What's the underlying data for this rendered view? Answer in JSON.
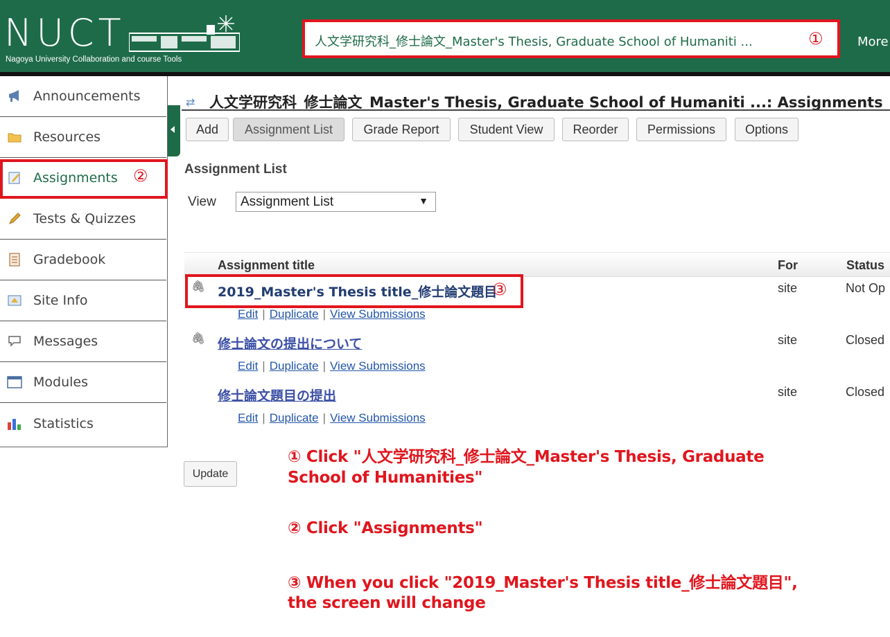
{
  "header": {
    "logo_text": "NUCT",
    "logo_subtitle": "Nagoya University Collaboration and course Tools",
    "site_tab_label": "人文学研究科_修士論文_Master's Thesis, Graduate School of Humaniti ...",
    "site_tab_marker": "①",
    "more_sites_label": "More"
  },
  "sidebar": {
    "items": [
      {
        "label": "Announcements",
        "icon": "megaphone-icon"
      },
      {
        "label": "Resources",
        "icon": "folder-icon"
      },
      {
        "label": "Assignments",
        "icon": "assignment-icon"
      },
      {
        "label": "Tests & Quizzes",
        "icon": "pencil-icon"
      },
      {
        "label": "Gradebook",
        "icon": "gradebook-icon"
      },
      {
        "label": "Site Info",
        "icon": "site-info-icon"
      },
      {
        "label": "Messages",
        "icon": "speech-bubble-icon"
      },
      {
        "label": "Modules",
        "icon": "window-icon"
      },
      {
        "label": "Statistics",
        "icon": "bar-chart-icon"
      }
    ],
    "active_marker": "②"
  },
  "main": {
    "page_title": "人文学研究科_修士論文_Master's Thesis, Graduate School of Humaniti ...: Assignments",
    "toolbar": {
      "add": "Add",
      "assignment_list": "Assignment List",
      "grade_report": "Grade Report",
      "student_view": "Student View",
      "reorder": "Reorder",
      "permissions": "Permissions",
      "options": "Options"
    },
    "section_heading": "Assignment List",
    "view_label": "View",
    "view_select_value": "Assignment List",
    "table": {
      "columns": {
        "title": "Assignment title",
        "for": "For",
        "status": "Status"
      },
      "rows": [
        {
          "title": "2019_Master's Thesis title_修士論文題目",
          "for": "site",
          "status": "Not Op",
          "marker": "③"
        },
        {
          "title": "修士論文の提出について",
          "for": "site",
          "status": "Closed"
        },
        {
          "title": "修士論文題目の提出",
          "for": "site",
          "status": "Closed"
        }
      ],
      "actions": {
        "edit": "Edit",
        "duplicate": "Duplicate",
        "view_submissions": "View Submissions"
      }
    },
    "update_label": "Update"
  },
  "instructions": {
    "step1_line1": "① Click \"人文学研究科_修士論文_Master's Thesis, Graduate",
    "step1_line2": "School of Humanities\"",
    "step2": "② Click \"Assignments\"",
    "step3_line1": "③ When you click \"2019_Master's Thesis title_修士論文題目\",",
    "step3_line2": "the screen will change"
  },
  "colors": {
    "header_green": "#1e6b49",
    "highlight_red": "#e0161e",
    "link_blue": "#2356a8"
  }
}
